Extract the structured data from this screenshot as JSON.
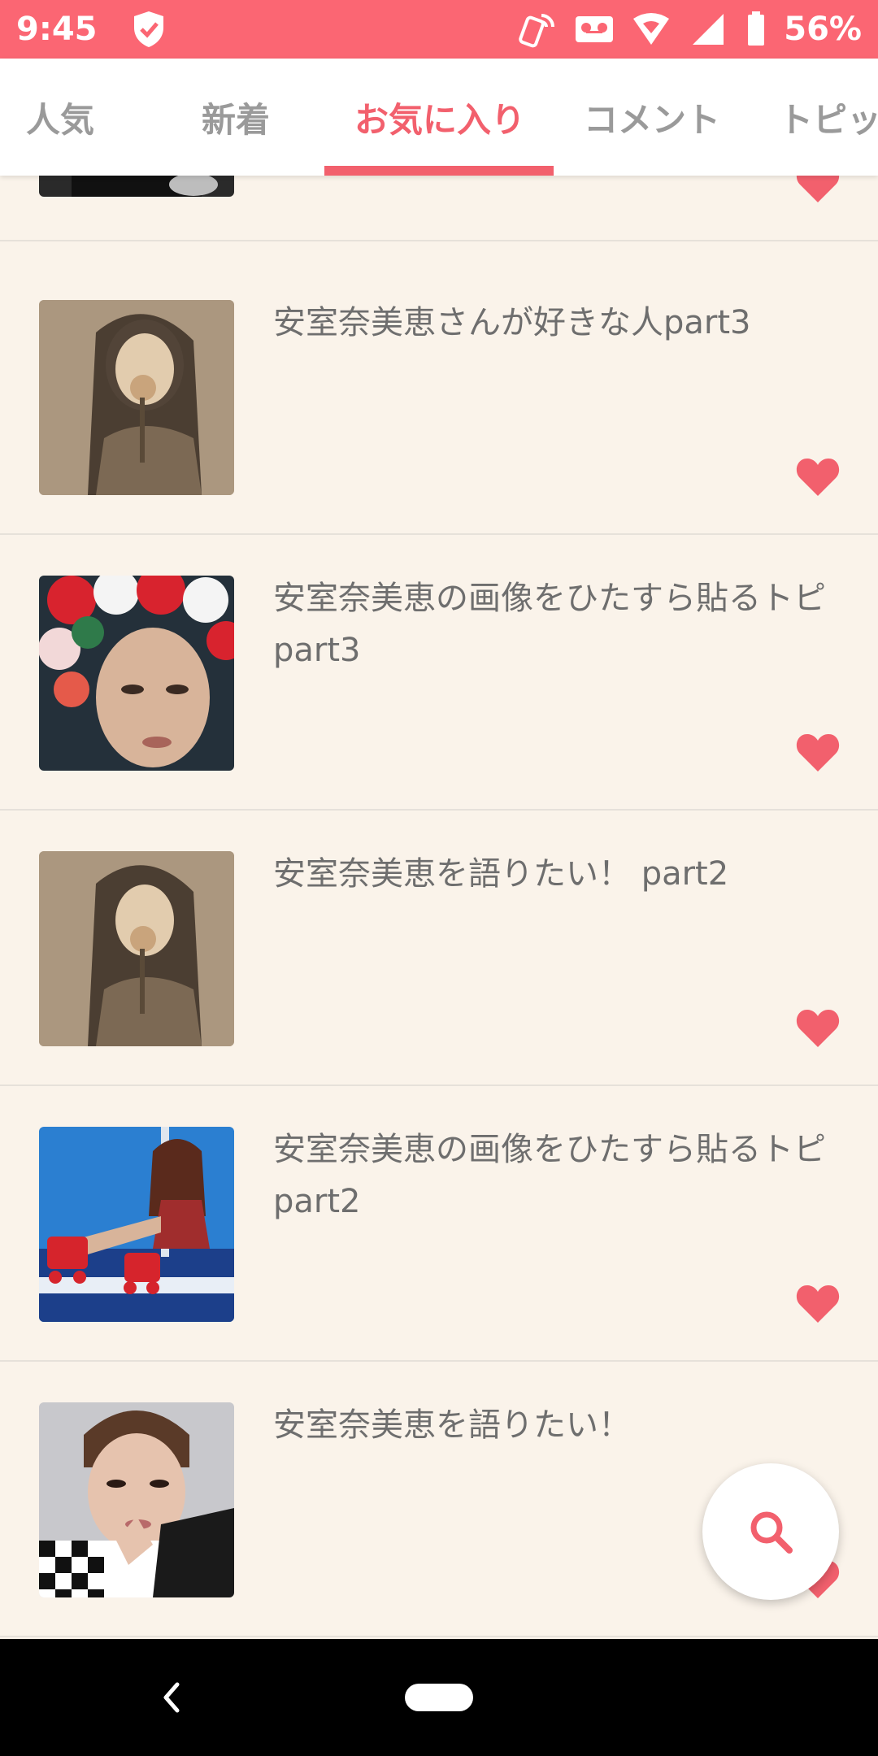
{
  "status_bar": {
    "time": "9:45",
    "battery": "56%",
    "icons": [
      "shield-check-icon",
      "nfc-phone-icon",
      "voicemail-icon",
      "wifi-icon",
      "signal-icon",
      "battery-icon"
    ]
  },
  "tabs": [
    {
      "label": "人気",
      "active": false
    },
    {
      "label": "新着",
      "active": false
    },
    {
      "label": "お気に入り",
      "active": true
    },
    {
      "label": "コメント",
      "active": false
    },
    {
      "label": "トピック",
      "active": false
    }
  ],
  "colors": {
    "accent": "#f2606d",
    "status_bar": "#fb6673",
    "background": "#faf3ea"
  },
  "list": {
    "items": [
      {
        "title": "",
        "favorited": true
      },
      {
        "title": "安室奈美恵さんが好きな人part3",
        "favorited": true
      },
      {
        "title": "安室奈美恵の画像をひたすら貼るトピ　part3",
        "favorited": true
      },
      {
        "title": "安室奈美恵を語りたい！ part2",
        "favorited": true
      },
      {
        "title": "安室奈美恵の画像をひたすら貼るトピpart2",
        "favorited": true
      },
      {
        "title": "安室奈美恵を語りたい！",
        "favorited": true
      }
    ]
  },
  "fab": {
    "icon": "search-icon"
  },
  "nav": {
    "back_icon": "back-chevron-icon",
    "home_icon": "home-pill-icon"
  }
}
